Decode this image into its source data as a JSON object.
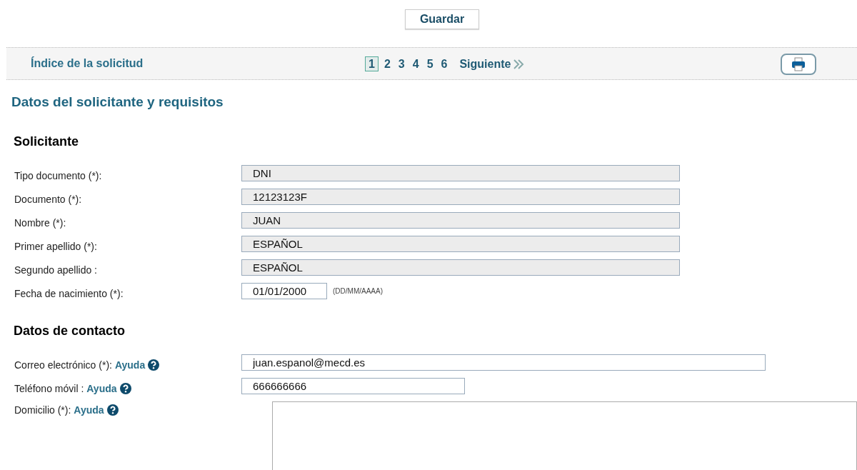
{
  "save_button": "Guardar",
  "index_bar": {
    "title": "Índice de la solicitud",
    "pages": [
      {
        "label": "1",
        "selected": true
      },
      {
        "label": "2",
        "selected": false
      },
      {
        "label": "3",
        "selected": false
      },
      {
        "label": "4",
        "selected": false
      },
      {
        "label": "5",
        "selected": false
      },
      {
        "label": "6",
        "selected": false
      }
    ],
    "next": "Siguiente"
  },
  "page_title": "Datos del solicitante y requisitos",
  "sections": [
    {
      "title": "Solicitante",
      "fields": [
        {
          "label": "Tipo documento (*):",
          "kind": "readonly",
          "value": "DNI"
        },
        {
          "label": "Documento (*):",
          "kind": "readonly",
          "value": "12123123F"
        },
        {
          "label": "Nombre (*):",
          "kind": "readonly",
          "value": "JUAN"
        },
        {
          "label": "Primer apellido (*):",
          "kind": "readonly",
          "value": "ESPAÑOL"
        },
        {
          "label": "Segundo apellido :",
          "kind": "readonly",
          "value": "ESPAÑOL"
        },
        {
          "label": "Fecha de nacimiento (*):",
          "kind": "date",
          "value": "01/01/2000",
          "hint": "(DD/MM/AAAA)"
        }
      ]
    },
    {
      "title": "Datos de contacto",
      "fields": [
        {
          "label": "Correo electrónico (*):",
          "help": "Ayuda",
          "kind": "wide",
          "value": "juan.espanol@mecd.es"
        },
        {
          "label": "Teléfono móvil :",
          "help": "Ayuda",
          "kind": "medium",
          "value": "666666666"
        },
        {
          "label": "Domicilio (*):",
          "help": "Ayuda",
          "kind": "textarea"
        }
      ]
    }
  ]
}
